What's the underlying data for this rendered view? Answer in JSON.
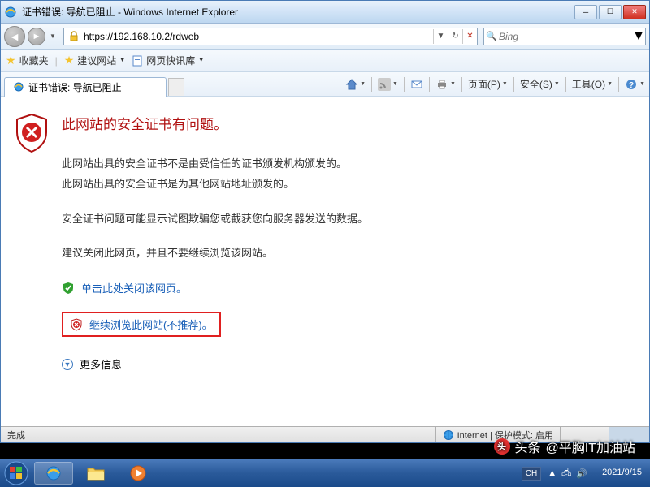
{
  "window": {
    "title": "证书错误: 导航已阻止 - Windows Internet Explorer"
  },
  "nav": {
    "url": "https://192.168.10.2/rdweb",
    "search_placeholder": "Bing"
  },
  "favbar": {
    "fav_label": "收藏夹",
    "site1": "建议网站",
    "site2": "网页快讯库"
  },
  "tab": {
    "title": "证书错误: 导航已阻止"
  },
  "cmd": {
    "page": "页面(P)",
    "safety": "安全(S)",
    "tools": "工具(O)"
  },
  "cert": {
    "heading": "此网站的安全证书有问题。",
    "line1": "此网站出具的安全证书不是由受信任的证书颁发机构颁发的。",
    "line2": "此网站出具的安全证书是为其他网站地址颁发的。",
    "line3": "安全证书问题可能显示试图欺骗您或截获您向服务器发送的数据。",
    "line4": "建议关闭此网页，并且不要继续浏览该网站。",
    "close_link": "单击此处关闭该网页。",
    "continue_link": "继续浏览此网站(不推荐)。",
    "more_info": "更多信息"
  },
  "status": {
    "done": "完成",
    "zone": "Internet | 保护模式: 启用"
  },
  "taskbar": {
    "lang": "CH",
    "date": "2021/9/15"
  },
  "watermark": {
    "prefix": "头条",
    "text": "@平胸IT加油站"
  }
}
